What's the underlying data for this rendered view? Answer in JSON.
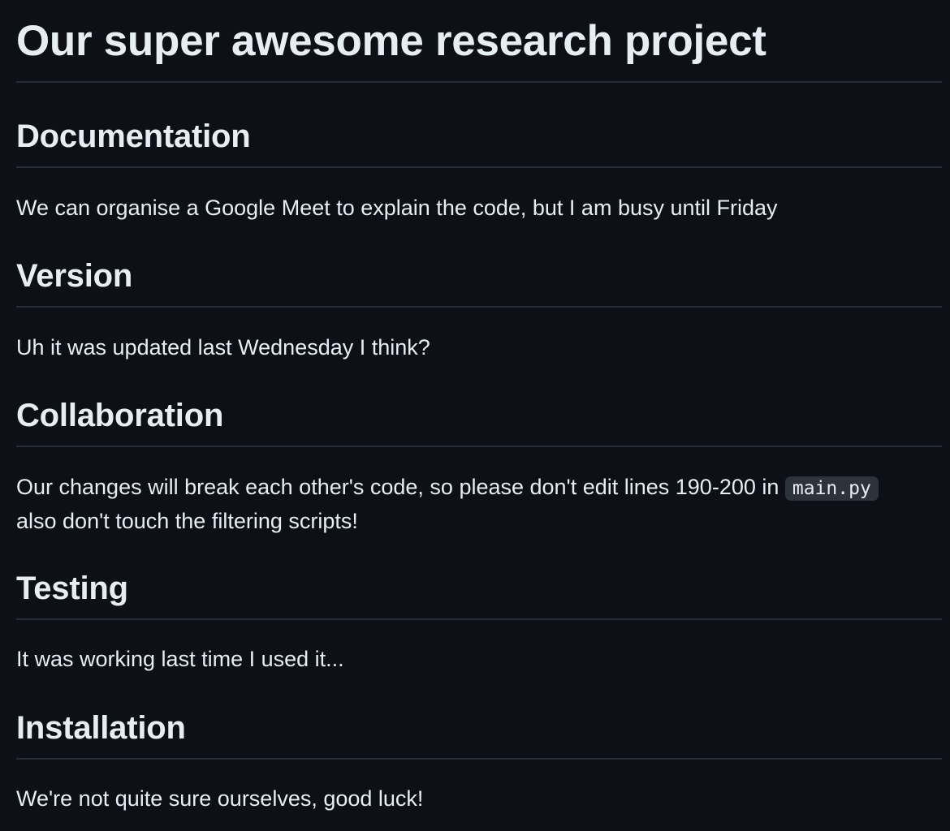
{
  "title": "Our super awesome research project",
  "sections": [
    {
      "heading": "Documentation",
      "text": "We can organise a Google Meet to explain the code, but I am busy until Friday"
    },
    {
      "heading": "Version",
      "text": "Uh it was updated last Wednesday I think?"
    },
    {
      "heading": "Collaboration",
      "text_before_code": "Our changes will break each other's code, so please don't edit lines 190-200 in ",
      "code": "main.py",
      "text_second_line": "also don't touch the filtering scripts!"
    },
    {
      "heading": "Testing",
      "text": "It was working last time I used it..."
    },
    {
      "heading": "Installation",
      "text": "We're not quite sure ourselves, good luck!"
    }
  ]
}
